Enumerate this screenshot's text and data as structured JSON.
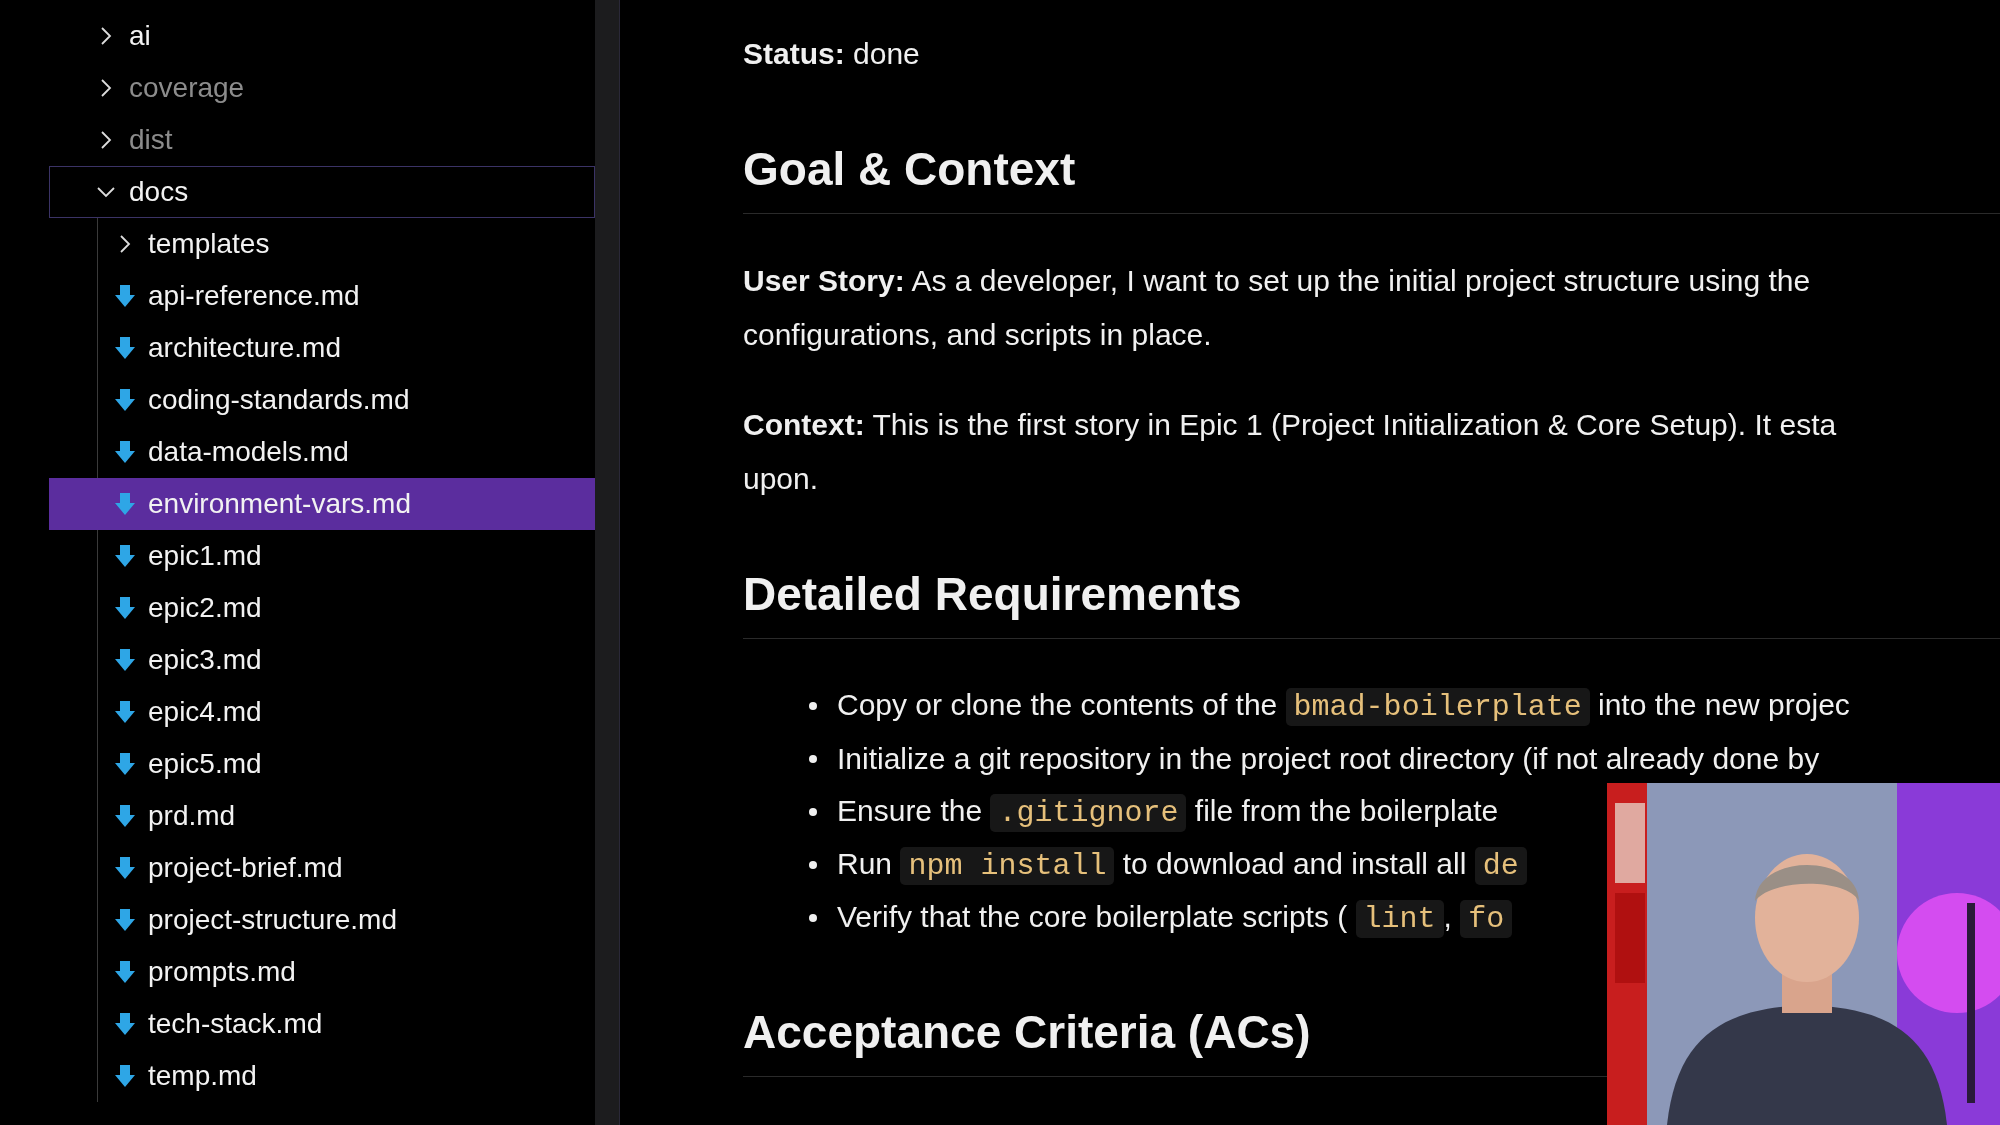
{
  "explorer": {
    "items": [
      {
        "kind": "folder",
        "label": "ai",
        "expanded": false,
        "dimmed": false,
        "selected": false,
        "focused": false
      },
      {
        "kind": "folder",
        "label": "coverage",
        "expanded": false,
        "dimmed": true,
        "selected": false,
        "focused": false
      },
      {
        "kind": "folder",
        "label": "dist",
        "expanded": false,
        "dimmed": true,
        "selected": false,
        "focused": false
      },
      {
        "kind": "folder",
        "label": "docs",
        "expanded": true,
        "dimmed": false,
        "selected": false,
        "focused": true,
        "children": [
          {
            "kind": "folder",
            "label": "templates",
            "expanded": false,
            "dimmed": false,
            "selected": false,
            "focused": false
          },
          {
            "kind": "file",
            "label": "api-reference.md",
            "dimmed": false,
            "selected": false,
            "focused": false
          },
          {
            "kind": "file",
            "label": "architecture.md",
            "dimmed": false,
            "selected": false,
            "focused": false
          },
          {
            "kind": "file",
            "label": "coding-standards.md",
            "dimmed": false,
            "selected": false,
            "focused": false
          },
          {
            "kind": "file",
            "label": "data-models.md",
            "dimmed": false,
            "selected": false,
            "focused": false
          },
          {
            "kind": "file",
            "label": "environment-vars.md",
            "dimmed": false,
            "selected": true,
            "focused": false
          },
          {
            "kind": "file",
            "label": "epic1.md",
            "dimmed": false,
            "selected": false,
            "focused": false
          },
          {
            "kind": "file",
            "label": "epic2.md",
            "dimmed": false,
            "selected": false,
            "focused": false
          },
          {
            "kind": "file",
            "label": "epic3.md",
            "dimmed": false,
            "selected": false,
            "focused": false
          },
          {
            "kind": "file",
            "label": "epic4.md",
            "dimmed": false,
            "selected": false,
            "focused": false
          },
          {
            "kind": "file",
            "label": "epic5.md",
            "dimmed": false,
            "selected": false,
            "focused": false
          },
          {
            "kind": "file",
            "label": "prd.md",
            "dimmed": false,
            "selected": false,
            "focused": false
          },
          {
            "kind": "file",
            "label": "project-brief.md",
            "dimmed": false,
            "selected": false,
            "focused": false
          },
          {
            "kind": "file",
            "label": "project-structure.md",
            "dimmed": false,
            "selected": false,
            "focused": false
          },
          {
            "kind": "file",
            "label": "prompts.md",
            "dimmed": false,
            "selected": false,
            "focused": false
          },
          {
            "kind": "file",
            "label": "tech-stack.md",
            "dimmed": false,
            "selected": false,
            "focused": false
          },
          {
            "kind": "file",
            "label": "temp.md",
            "dimmed": false,
            "selected": false,
            "focused": false
          }
        ]
      }
    ]
  },
  "document": {
    "blocks": [
      {
        "kind": "paragraph",
        "lines": [
          "**Status:** done"
        ]
      },
      {
        "kind": "heading",
        "text": "Goal & Context"
      },
      {
        "kind": "paragraph",
        "lines": [
          "**User Story:** As a developer, I want to set up the initial project structure using the",
          "configurations, and scripts in place."
        ]
      },
      {
        "kind": "paragraph",
        "lines": [
          "**Context:** This is the first story in Epic 1 (Project Initialization & Core Setup). It esta",
          "upon."
        ]
      },
      {
        "kind": "heading",
        "text": "Detailed Requirements"
      },
      {
        "kind": "list",
        "items": [
          [
            {
              "kind": "text",
              "text": "Copy or clone the contents of the "
            },
            {
              "kind": "code",
              "text": "bmad-boilerplate"
            },
            {
              "kind": "text",
              "text": " into the new projec"
            }
          ],
          [
            {
              "kind": "text",
              "text": "Initialize a git repository in the project root directory (if not already done by"
            }
          ],
          [
            {
              "kind": "text",
              "text": "Ensure the "
            },
            {
              "kind": "code",
              "text": ".gitignore"
            },
            {
              "kind": "text",
              "text": " file from the boilerplate"
            }
          ],
          [
            {
              "kind": "text",
              "text": "Run "
            },
            {
              "kind": "code",
              "text": "npm install"
            },
            {
              "kind": "text",
              "text": " to download and install all "
            },
            {
              "kind": "code",
              "text": "de"
            }
          ],
          [
            {
              "kind": "text",
              "text": "Verify that the core boilerplate scripts ( "
            },
            {
              "kind": "code",
              "text": "lint"
            },
            {
              "kind": "text",
              "text": ", "
            },
            {
              "kind": "code",
              "text": "fo"
            }
          ]
        ]
      },
      {
        "kind": "heading",
        "text": "Acceptance Criteria (ACs)"
      }
    ]
  }
}
